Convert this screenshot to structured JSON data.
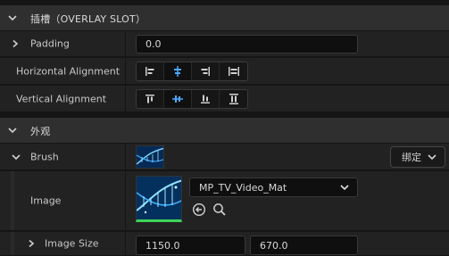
{
  "overlay_slot": {
    "header": "插槽（OVERLAY SLOT）",
    "padding_label": "Padding",
    "padding_value": "0.0",
    "halign_label": "Horizontal Alignment",
    "valign_label": "Vertical Alignment",
    "halign_selected_index": 1,
    "valign_selected_index": 1
  },
  "appearance": {
    "header": "外观",
    "brush_label": "Brush",
    "bind_button": "绑定",
    "image_label": "Image",
    "image_asset": "MP_TV_Video_Mat",
    "image_size_label": "Image Size",
    "image_size_x": "1150.0",
    "image_size_y": "670.0"
  },
  "colors": {
    "accent": "#4aa8ff",
    "thumb_green": "#3fd25a"
  },
  "icons": [
    "chevron-down-icon",
    "chevron-right-icon",
    "align-left-icon",
    "align-center-icon",
    "align-right-icon",
    "align-fill-icon",
    "align-top-icon",
    "align-middle-icon",
    "align-bottom-icon",
    "valign-fill-icon",
    "use-selected-arrow-icon",
    "browse-search-icon"
  ]
}
